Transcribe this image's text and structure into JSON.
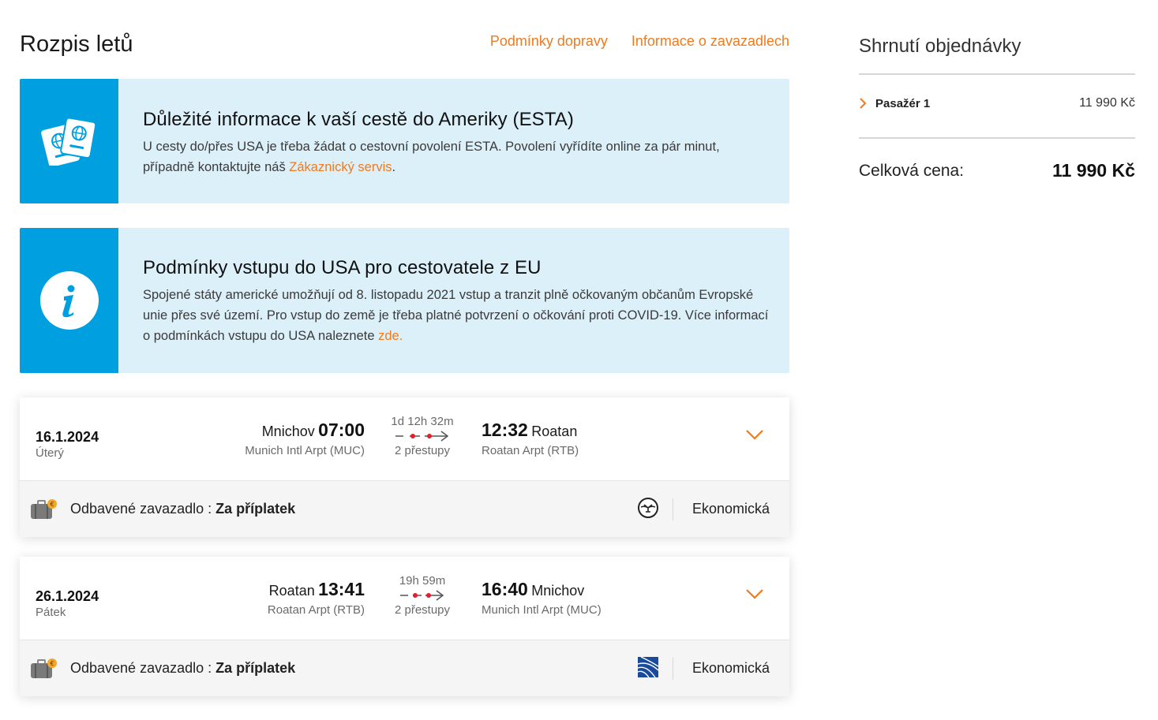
{
  "header": {
    "title": "Rozpis letů",
    "links": [
      "Podmínky dopravy",
      "Informace o zavazadlech"
    ]
  },
  "esta": {
    "title": "Důležité informace k vaší cestě do Ameriky (ESTA)",
    "text": "U cesty do/přes USA je třeba žádat o cestovní povolení ESTA. Povolení vyřídíte online za pár minut, případně kontaktujte náš ",
    "link": "Zákaznický servis",
    "text_after": "."
  },
  "covid": {
    "title": "Podmínky vstupu do USA pro cestovatele z EU",
    "text": "Spojené státy americké umožňují od 8. listopadu 2021 vstup a tranzit plně očkovaným občanům Evropské unie přes své území. Pro vstup do země je třeba platné potvrzení o očkování proti COVID-19. Více informací o podmínkách vstupu do USA naleznete ",
    "link": "zde."
  },
  "flights": [
    {
      "date": "16.1.2024",
      "day": "Úterý",
      "dep_city": "Mnichov",
      "dep_time": "07:00",
      "dep_airport": "Munich Intl Arpt (MUC)",
      "duration": "1d 12h 32m",
      "stops": "2 přestupy",
      "arr_time": "12:32",
      "arr_city": "Roatan",
      "arr_airport": "Roatan Arpt (RTB)",
      "baggage_label": "Odbavené zavazadlo : ",
      "baggage_value": "Za příplatek",
      "cabin": "Ekonomická",
      "airline_icon": "lufthansa-logo"
    },
    {
      "date": "26.1.2024",
      "day": "Pátek",
      "dep_city": "Roatan",
      "dep_time": "13:41",
      "dep_airport": "Roatan Arpt (RTB)",
      "duration": "19h 59m",
      "stops": "2 přestupy",
      "arr_time": "16:40",
      "arr_city": "Mnichov",
      "arr_airport": "Munich Intl Arpt (MUC)",
      "baggage_label": "Odbavené zavazadlo : ",
      "baggage_value": "Za příplatek",
      "cabin": "Ekonomická",
      "airline_icon": "united-logo"
    }
  ],
  "summary": {
    "title": "Shrnutí objednávky",
    "passenger_label": "Pasažér 1",
    "passenger_price": "11 990 Kč",
    "total_label": "Celková cena:",
    "total_price": "11 990 Kč"
  },
  "colors": {
    "accent": "#f07a1e",
    "info_bg": "#dcf0fa",
    "info_icon_bg": "#00a0e0",
    "route_dot": "#e0202a"
  }
}
